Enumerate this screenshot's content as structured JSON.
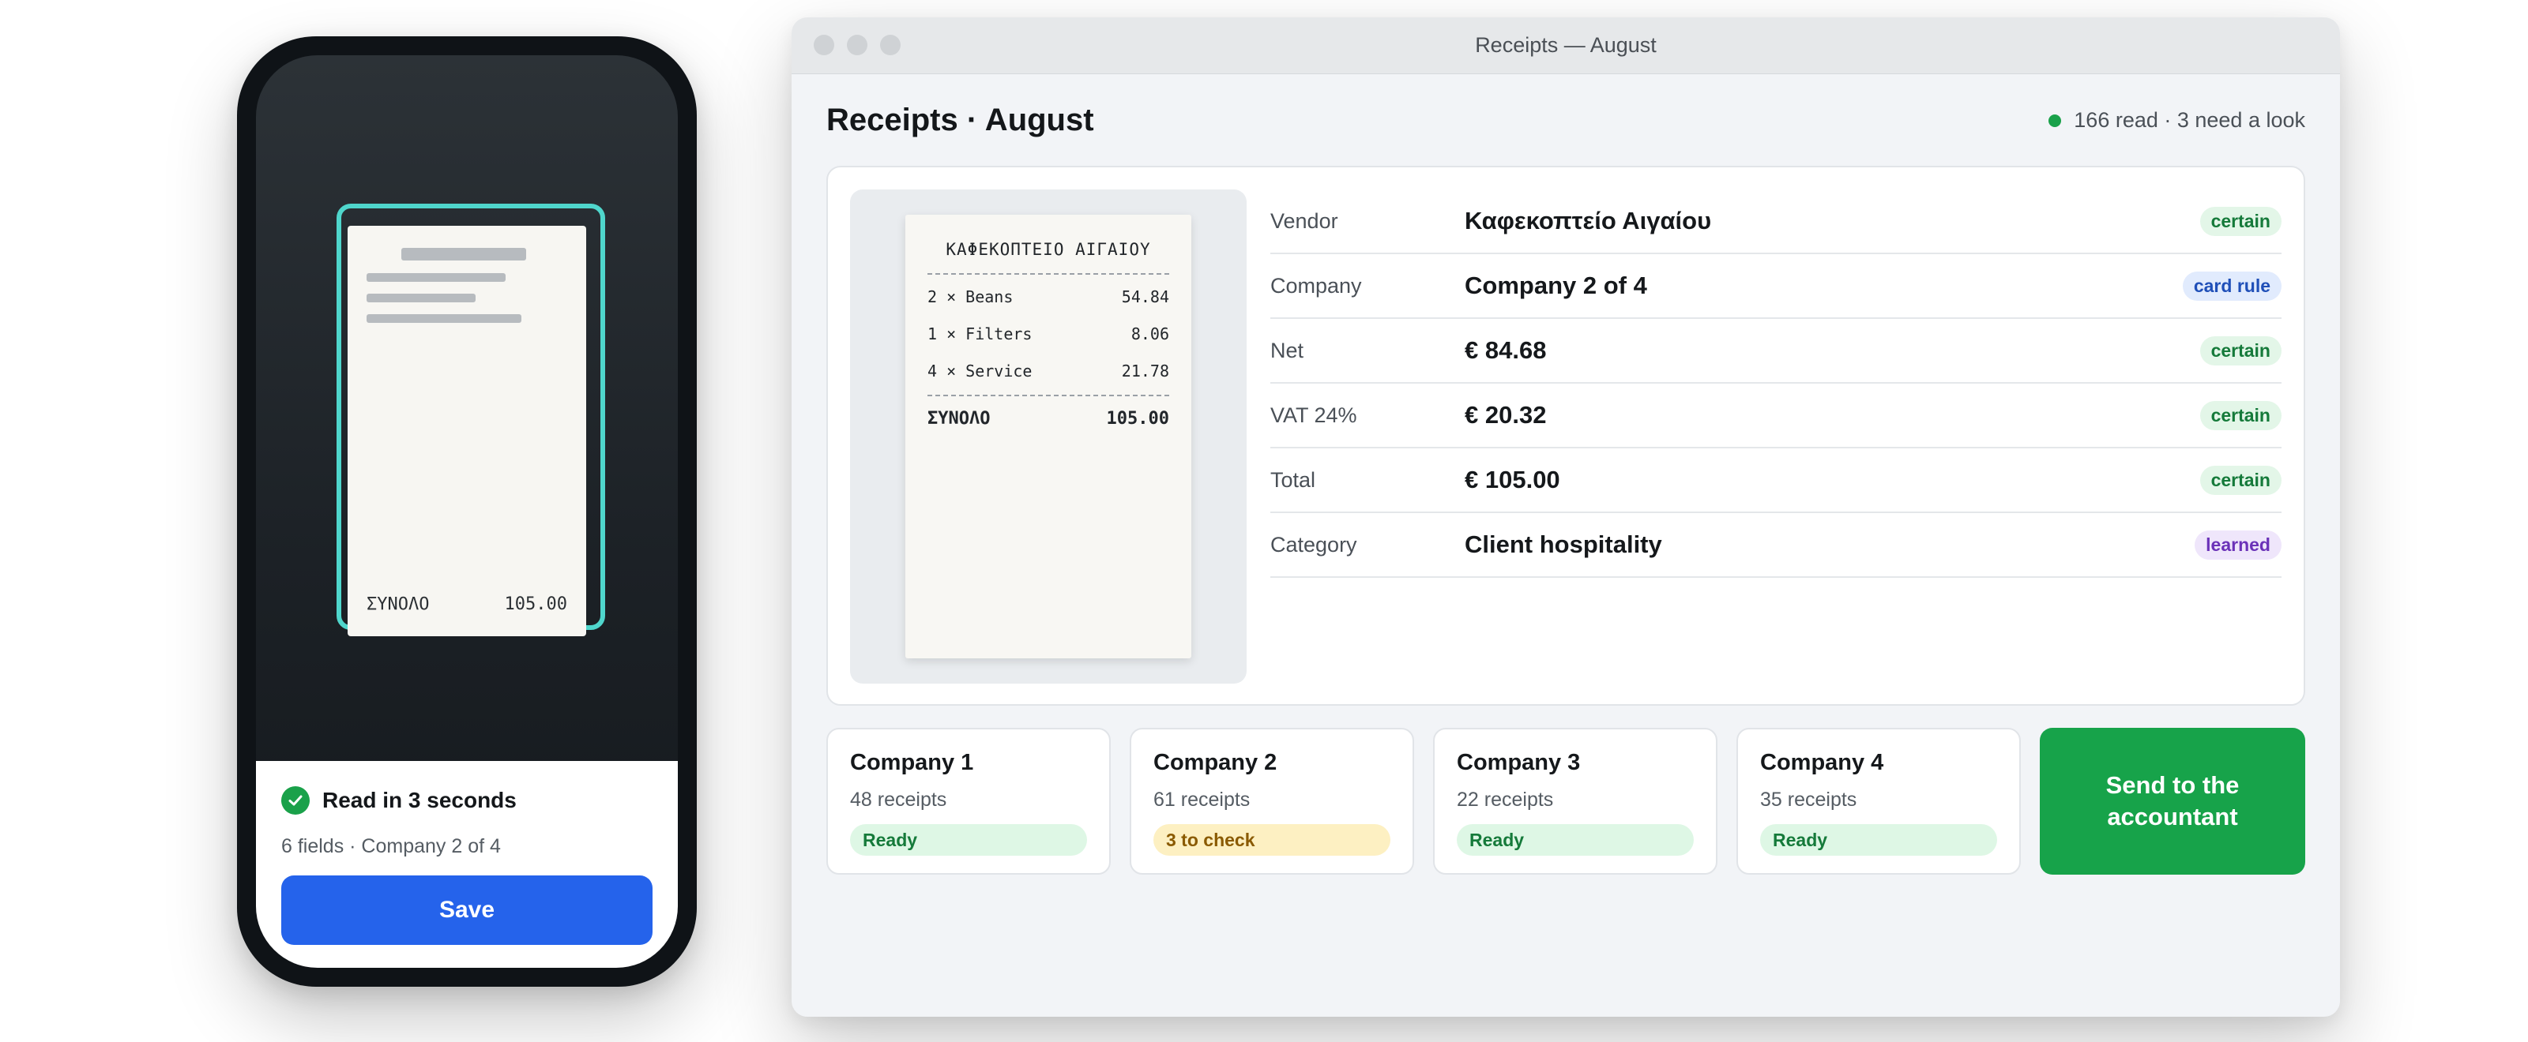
{
  "phone": {
    "mini_receipt": {
      "total_label": "ΣΥΝΟΛΟ",
      "total_value": "105.00"
    },
    "sheet": {
      "title": "Read in 3 seconds",
      "subtitle": "6 fields · Company 2 of 4",
      "save_label": "Save"
    }
  },
  "window": {
    "title": "Receipts — August",
    "page_title": "Receipts · August",
    "status": "166 read · 3 need a look",
    "receipt": {
      "vendor": "ΚΑΦΕΚΟΠΤΕΙΟ ΑΙΓΑΙΟΥ",
      "lines": [
        {
          "item": "2 × Beans",
          "amount": "54.84"
        },
        {
          "item": "1 × Filters",
          "amount": "8.06"
        },
        {
          "item": "4 × Service",
          "amount": "21.78"
        }
      ],
      "total_label": "ΣΥΝΟΛΟ",
      "total_value": "105.00"
    },
    "fields": [
      {
        "label": "Vendor",
        "value": "Καφεκοπτείο Αιγαίου",
        "tag": "certain",
        "tag_bg": "#e3f6e8",
        "tag_color": "#157a3a"
      },
      {
        "label": "Company",
        "value": "Company 2 of 4",
        "tag": "card rule",
        "tag_bg": "#e1ebfd",
        "tag_color": "#1f4fb8"
      },
      {
        "label": "Net",
        "value": "€ 84.68",
        "tag": "certain",
        "tag_bg": "#e3f6e8",
        "tag_color": "#157a3a"
      },
      {
        "label": "VAT 24%",
        "value": "€ 20.32",
        "tag": "certain",
        "tag_bg": "#e3f6e8",
        "tag_color": "#157a3a"
      },
      {
        "label": "Total",
        "value": "€ 105.00",
        "tag": "certain",
        "tag_bg": "#e3f6e8",
        "tag_color": "#157a3a"
      },
      {
        "label": "Category",
        "value": "Client hospitality",
        "tag": "learned",
        "tag_bg": "#efe6fb",
        "tag_color": "#6b32b8"
      }
    ],
    "companies": [
      {
        "name": "Company 1",
        "count": "48 receipts",
        "badge": "Ready",
        "badge_bg": "#def7e5",
        "badge_color": "#157a3a"
      },
      {
        "name": "Company 2",
        "count": "61 receipts",
        "badge": "3 to check",
        "badge_bg": "#fdf0c2",
        "badge_color": "#8a5a00"
      },
      {
        "name": "Company 3",
        "count": "22 receipts",
        "badge": "Ready",
        "badge_bg": "#def7e5",
        "badge_color": "#157a3a"
      },
      {
        "name": "Company 4",
        "count": "35 receipts",
        "badge": "Ready",
        "badge_bg": "#def7e5",
        "badge_color": "#157a3a"
      }
    ],
    "send_label": "Send to the accountant"
  },
  "colors": {
    "accent_blue": "#2563eb",
    "success_green": "#17a34a",
    "scan_frame": "#4fd6cc"
  },
  "icons": {
    "read_status": "check-circle-icon",
    "status_indicator": "status-dot-icon"
  }
}
